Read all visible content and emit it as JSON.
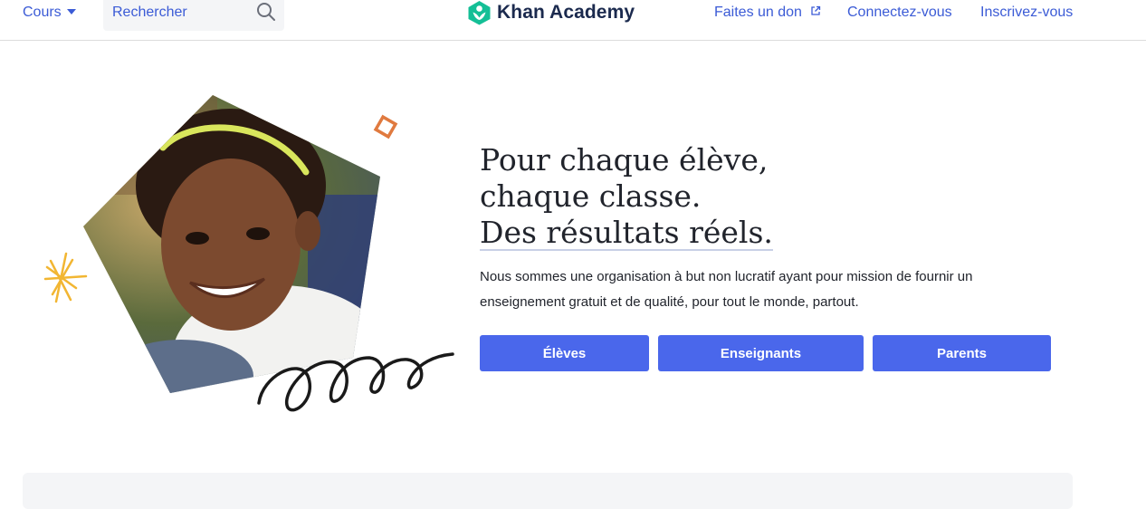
{
  "nav": {
    "courses_label": "Cours",
    "search_placeholder": "Rechercher",
    "logo_text": "Khan Academy",
    "donate_label": "Faites un don",
    "login_label": "Connectez-vous",
    "signup_label": "Inscrivez-vous"
  },
  "hero": {
    "headline_line1": "Pour chaque élève,",
    "headline_line2": "chaque classe.",
    "headline_line3": "Des résultats réels.",
    "description": "Nous sommes une organisation à but non lucratif ayant pour mission de fournir un enseignement gratuit et de qualité, pour tout le monde, partout.",
    "buttons": {
      "students": "Élèves",
      "teachers": "Enseignants",
      "parents": "Parents"
    }
  },
  "colors": {
    "link": "#3b5bd6",
    "primary_button": "#4a67eb",
    "logo_green": "#14bf96",
    "logo_text": "#1b2a4e"
  },
  "icons": [
    "chevron-down-icon",
    "search-icon",
    "khan-academy-logo",
    "external-link-icon"
  ]
}
